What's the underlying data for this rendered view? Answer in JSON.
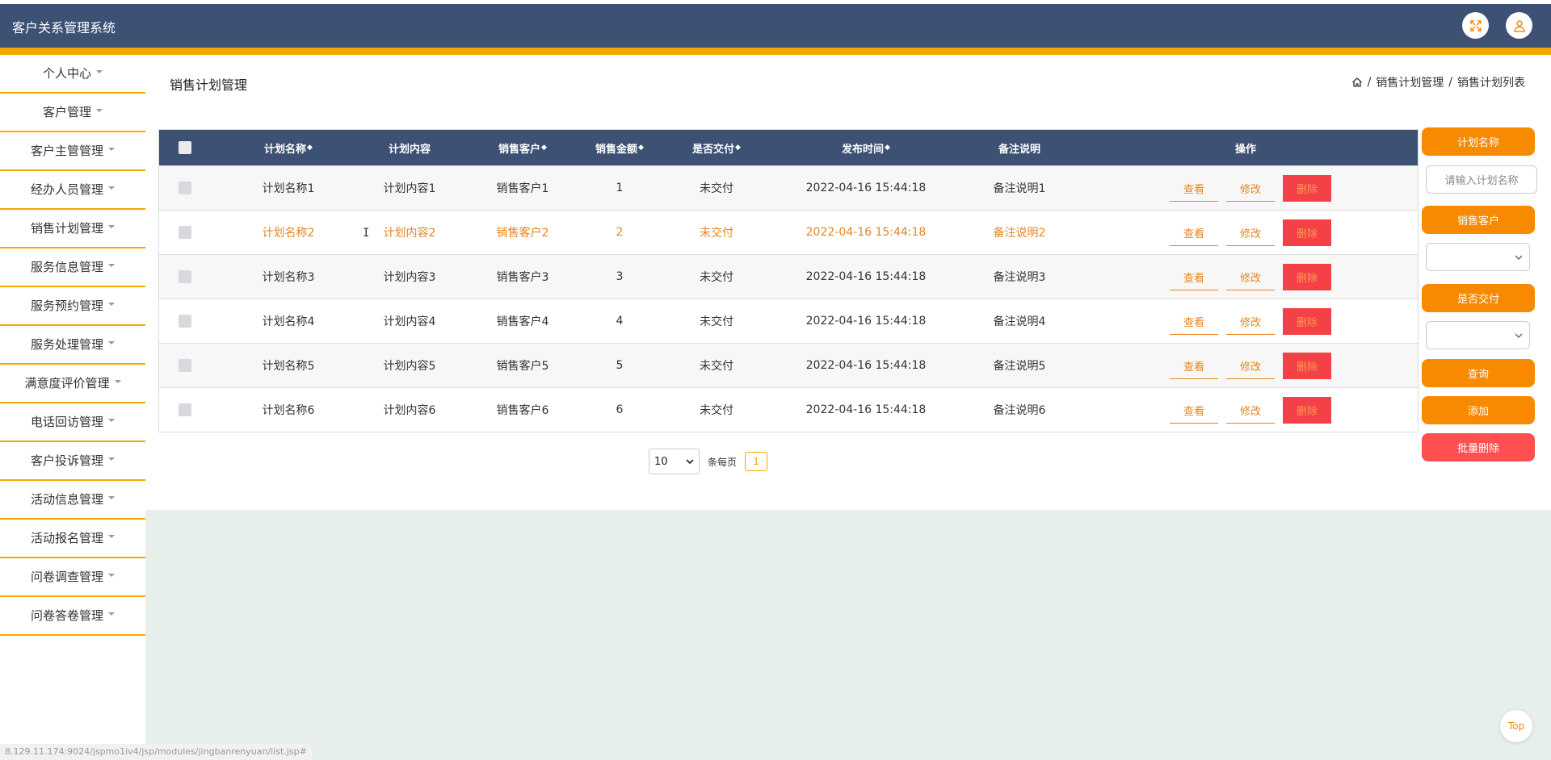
{
  "app": {
    "title": "客户关系管理系统"
  },
  "header": {
    "icons": [
      "fullscreen-icon",
      "user-icon"
    ],
    "brand_color": "#3d5175",
    "accent_color": "#f6a800"
  },
  "sidebar": {
    "items": [
      {
        "label": "个人中心"
      },
      {
        "label": "客户管理"
      },
      {
        "label": "客户主管管理"
      },
      {
        "label": "经办人员管理"
      },
      {
        "label": "销售计划管理"
      },
      {
        "label": "服务信息管理"
      },
      {
        "label": "服务预约管理"
      },
      {
        "label": "服务处理管理"
      },
      {
        "label": "满意度评价管理"
      },
      {
        "label": "电话回访管理"
      },
      {
        "label": "客户投诉管理"
      },
      {
        "label": "活动信息管理"
      },
      {
        "label": "活动报名管理"
      },
      {
        "label": "问卷调查管理"
      },
      {
        "label": "问卷答卷管理"
      }
    ]
  },
  "page": {
    "title": "销售计划管理"
  },
  "breadcrumb": {
    "home_icon": "home-icon",
    "items": [
      "销售计划管理",
      "销售计划列表"
    ],
    "sep": "/"
  },
  "table": {
    "headers": [
      "计划名称",
      "计划内容",
      "销售客户",
      "销售金额",
      "是否交付",
      "发布时间",
      "备注说明",
      "操作"
    ],
    "sortable": [
      true,
      false,
      true,
      true,
      true,
      true,
      false,
      false
    ],
    "rows": [
      {
        "name": "计划名称1",
        "content": "计划内容1",
        "customer": "销售客户1",
        "amount": "1",
        "delivered": "未交付",
        "time": "2022-04-16 15:44:18",
        "remark": "备注说明1"
      },
      {
        "name": "计划名称2",
        "content": "计划内容2",
        "customer": "销售客户2",
        "amount": "2",
        "delivered": "未交付",
        "time": "2022-04-16 15:44:18",
        "remark": "备注说明2"
      },
      {
        "name": "计划名称3",
        "content": "计划内容3",
        "customer": "销售客户3",
        "amount": "3",
        "delivered": "未交付",
        "time": "2022-04-16 15:44:18",
        "remark": "备注说明3"
      },
      {
        "name": "计划名称4",
        "content": "计划内容4",
        "customer": "销售客户4",
        "amount": "4",
        "delivered": "未交付",
        "time": "2022-04-16 15:44:18",
        "remark": "备注说明4"
      },
      {
        "name": "计划名称5",
        "content": "计划内容5",
        "customer": "销售客户5",
        "amount": "5",
        "delivered": "未交付",
        "time": "2022-04-16 15:44:18",
        "remark": "备注说明5"
      },
      {
        "name": "计划名称6",
        "content": "计划内容6",
        "customer": "销售客户6",
        "amount": "6",
        "delivered": "未交付",
        "time": "2022-04-16 15:44:18",
        "remark": "备注说明6"
      }
    ],
    "actions": {
      "view": "查看",
      "edit": "修改",
      "delete": "删除"
    }
  },
  "pagination": {
    "page_size": "10",
    "per_page_label": "条每页",
    "current_page": "1"
  },
  "search_panel": {
    "plan_name_label": "计划名称",
    "plan_name_placeholder": "请输入计划名称",
    "customer_label": "销售客户",
    "delivered_label": "是否交付",
    "query_button": "查询",
    "add_button": "添加",
    "batch_delete_button": "批量删除"
  },
  "status_bar": {
    "url": "8.129.11.174:9024/jspmo1iv4/jsp/modules/jingbanrenyuan/list.jsp#"
  },
  "back_to_top": "Top"
}
